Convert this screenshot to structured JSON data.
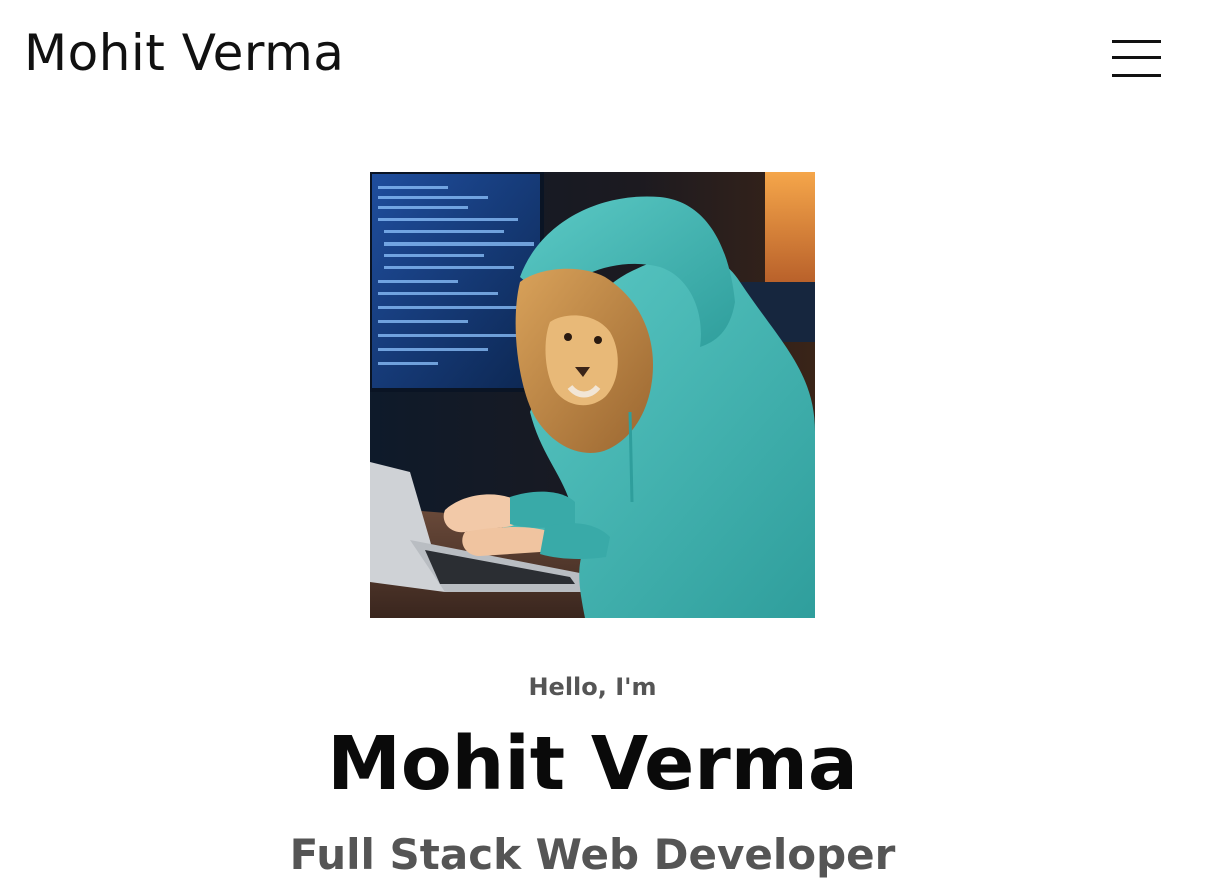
{
  "nav": {
    "logo": "Mohit Verma",
    "menu_icon": "hamburger-menu-icon"
  },
  "profile": {
    "image_alt": "Lion in a teal hoodie typing on a laptop"
  },
  "hero": {
    "greeting": "Hello, I'm",
    "name": "Mohit Verma",
    "role": "Full Stack Web Developer"
  },
  "colors": {
    "text_dark": "#111111",
    "text_muted": "#555555",
    "hoodie": "#3fb6b4"
  }
}
